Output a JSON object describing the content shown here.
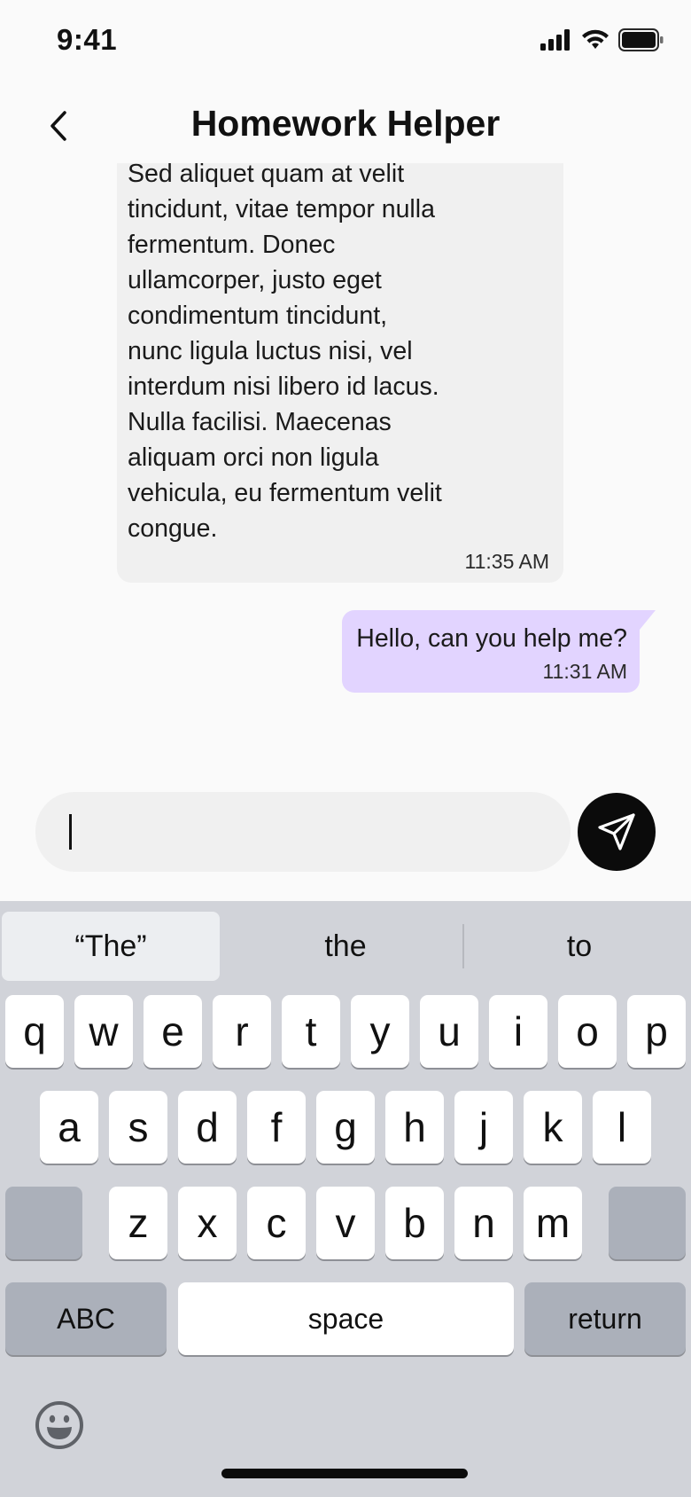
{
  "status_bar": {
    "time": "9:41",
    "icons": [
      "cellular-signal-icon",
      "wifi-icon",
      "battery-icon"
    ]
  },
  "header": {
    "title": "Homework Helper",
    "back_icon": "chevron-left-icon"
  },
  "messages": [
    {
      "type": "received",
      "text": "consectetur adipiscing elit.\nSed aliquet  quam at velit\ntincidunt, vitae tempor nulla\nfermentum. Donec\nullamcorper, justo eget\ncondimentum tincidunt,\nnunc ligula luctus nisi,  vel\ninterdum nisi libero id lacus.\nNulla facilisi. Maecenas\naliquam orci  non ligula\nvehicula, eu fermentum velit\ncongue.",
      "time": "11:35 AM"
    },
    {
      "type": "sent",
      "text": "Hello, can you help me?",
      "time": "11:31 AM"
    }
  ],
  "composer": {
    "value": "",
    "placeholder": "",
    "send_icon": "send-icon"
  },
  "keyboard": {
    "suggestions": [
      "“The”",
      "the",
      "to"
    ],
    "row1": [
      "q",
      "w",
      "e",
      "r",
      "t",
      "y",
      "u",
      "i",
      "o",
      "p"
    ],
    "row2": [
      "a",
      "s",
      "d",
      "f",
      "g",
      "h",
      "j",
      "k",
      "l"
    ],
    "row3": [
      "z",
      "x",
      "c",
      "v",
      "b",
      "n",
      "m"
    ],
    "abc_label": "ABC",
    "space_label": "space",
    "return_label": "return",
    "emoji_icon": "emoji-icon"
  },
  "colors": {
    "sent_bubble": "#e2d4ff",
    "received_bubble": "#f0f0f0",
    "send_button": "#0b0b0b",
    "keyboard_bg": "#d1d3d9"
  }
}
